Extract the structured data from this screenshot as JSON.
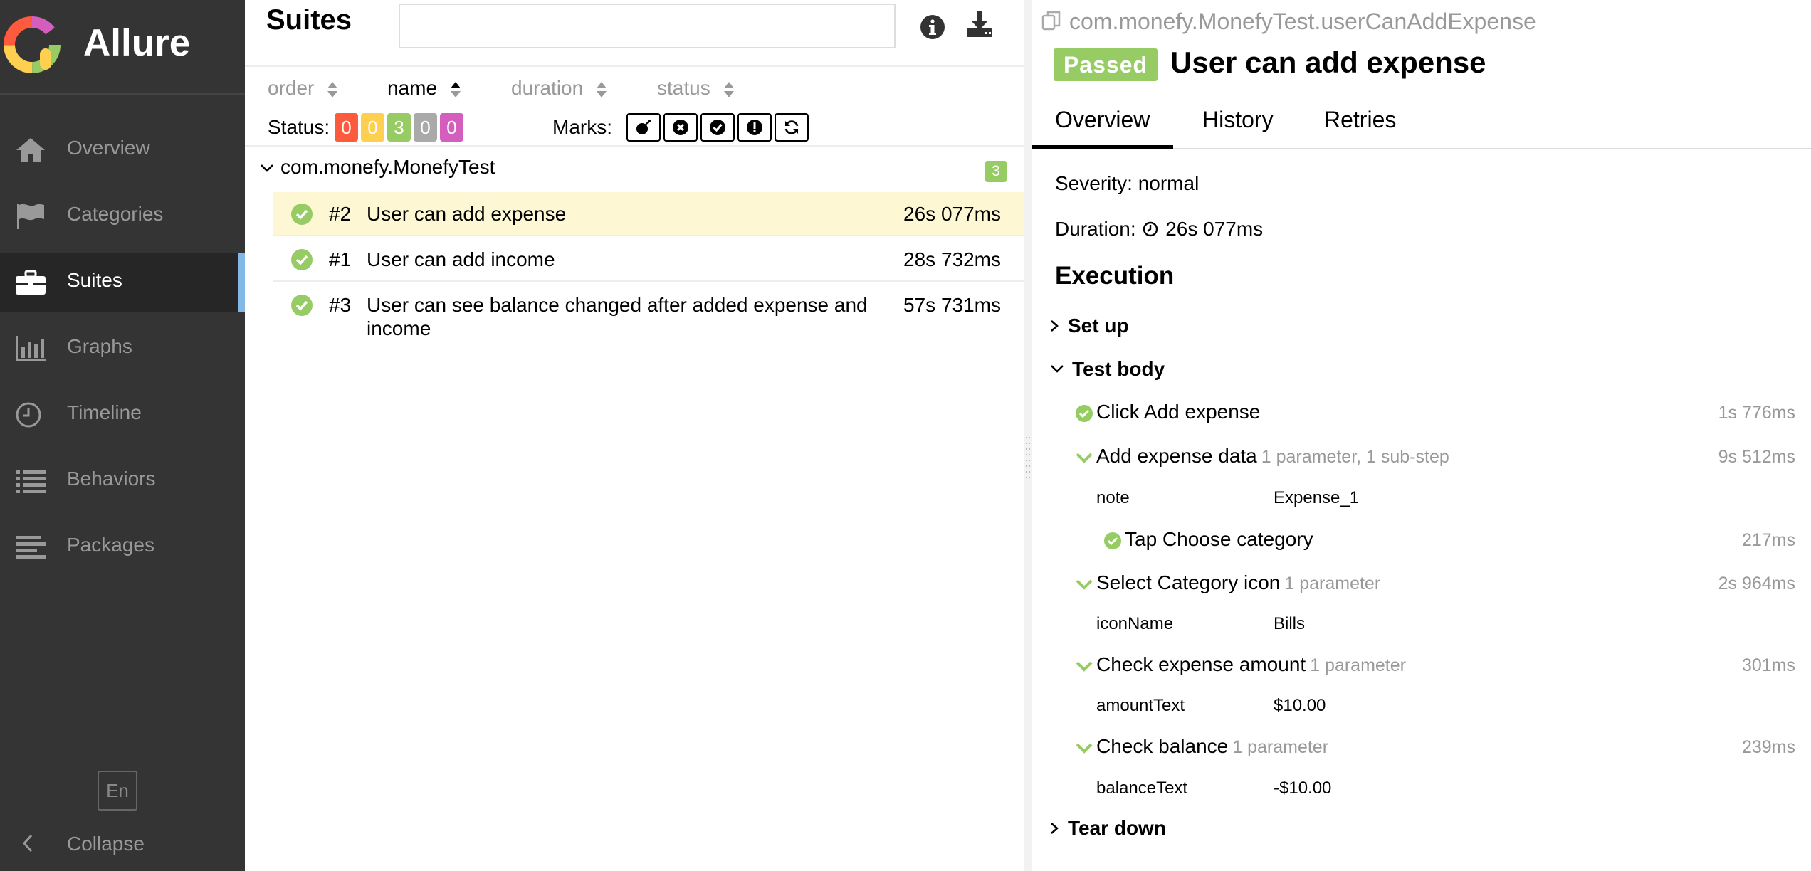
{
  "sidebar": {
    "brand": "Allure",
    "items": [
      {
        "label": "Overview",
        "icon": "home-icon"
      },
      {
        "label": "Categories",
        "icon": "flag-icon"
      },
      {
        "label": "Suites",
        "icon": "briefcase-icon",
        "active": true
      },
      {
        "label": "Graphs",
        "icon": "bar-chart-icon"
      },
      {
        "label": "Timeline",
        "icon": "clock-icon"
      },
      {
        "label": "Behaviors",
        "icon": "list-icon"
      },
      {
        "label": "Packages",
        "icon": "align-left-icon"
      }
    ],
    "language": "En",
    "collapse": "Collapse"
  },
  "suites": {
    "title": "Suites",
    "search": {
      "value": "",
      "placeholder": ""
    },
    "sort": [
      {
        "label": "order"
      },
      {
        "label": "name",
        "active": true
      },
      {
        "label": "duration"
      },
      {
        "label": "status"
      }
    ],
    "status_label": "Status:",
    "status_counts": [
      {
        "value": "0",
        "color": "#fd5a3e"
      },
      {
        "value": "0",
        "color": "#ffd050"
      },
      {
        "value": "3",
        "color": "#97cc64"
      },
      {
        "value": "0",
        "color": "#aaaaaa"
      },
      {
        "value": "0",
        "color": "#d35ebe"
      }
    ],
    "marks_label": "Marks:",
    "marks": [
      "bomb-icon",
      "x-circle-icon",
      "check-circle-icon",
      "exclamation-icon",
      "refresh-icon"
    ],
    "group": {
      "name": "com.monefy.MonefyTest",
      "count": "3"
    },
    "tests": [
      {
        "num": "#2",
        "name": "User can add expense",
        "duration": "26s 077ms",
        "selected": true
      },
      {
        "num": "#1",
        "name": "User can add income",
        "duration": "28s 732ms"
      },
      {
        "num": "#3",
        "name": "User can see balance changed after added expense and income",
        "duration": "57s 731ms"
      }
    ]
  },
  "detail": {
    "full_name": "com.monefy.MonefyTest.userCanAddExpense",
    "status": "Passed",
    "title": "User can add expense",
    "tabs": [
      "Overview",
      "History",
      "Retries"
    ],
    "severity": "Severity: normal",
    "duration_label": "Duration:",
    "duration": "26s 077ms",
    "execution_title": "Execution",
    "setup": "Set up",
    "test_body": "Test body",
    "teardown": "Tear down",
    "steps": [
      {
        "name": "Click Add expense",
        "meta": "",
        "duration": "1s 776ms"
      },
      {
        "name": "Add expense data",
        "meta": "1 parameter, 1 sub-step",
        "duration": "9s 512ms",
        "param": {
          "name": "note",
          "value": "Expense_1"
        },
        "substep": {
          "name": "Tap Choose category",
          "duration": "217ms"
        }
      },
      {
        "name": "Select Category icon",
        "meta": "1 parameter",
        "duration": "2s 964ms",
        "param": {
          "name": "iconName",
          "value": "Bills"
        }
      },
      {
        "name": "Check expense amount",
        "meta": "1 parameter",
        "duration": "301ms",
        "param": {
          "name": "amountText",
          "value": "$10.00"
        }
      },
      {
        "name": "Check balance",
        "meta": "1 parameter",
        "duration": "239ms",
        "param": {
          "name": "balanceText",
          "value": "-$10.00"
        }
      }
    ]
  }
}
